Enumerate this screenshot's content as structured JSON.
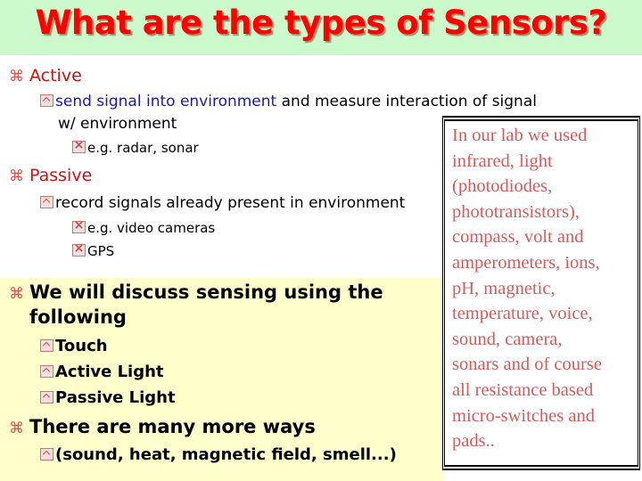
{
  "slide": {
    "title": "What are the types of Sensors?",
    "colors": {
      "title": "#ff0000",
      "title_band": "#ccf9cc",
      "heading": "#cc1111",
      "highlight": "#1a1aa6",
      "panel": "#ffffcc",
      "note_text": "#d65a5a"
    },
    "bullets": {
      "active": {
        "icon": "command-key-icon",
        "label": "Active",
        "sub": {
          "icon": "up-box-icon",
          "highlight": "send signal into environment",
          "rest_line1": " and measure interaction of signal",
          "rest_line2": "w/ environment",
          "example": {
            "icon": "x-box-icon",
            "label": "e.g. radar, sonar"
          }
        }
      },
      "passive": {
        "icon": "command-key-icon",
        "label": "Passive",
        "sub": {
          "icon": "up-box-icon",
          "label": "record signals already present in environment",
          "examples": [
            {
              "icon": "x-box-icon",
              "label": "e.g. video cameras"
            },
            {
              "icon": "x-box-icon",
              "label": "GPS"
            }
          ]
        }
      },
      "discuss": {
        "icon": "command-key-icon",
        "line1": "We will discuss sensing using the",
        "line2": "following",
        "items": [
          {
            "icon": "up-box-icon",
            "label": "Touch"
          },
          {
            "icon": "up-box-icon",
            "label": "Active Light"
          },
          {
            "icon": "up-box-icon",
            "label": "Passive Light"
          }
        ]
      },
      "more": {
        "icon": "command-key-icon",
        "label": "There are many more ways",
        "items": [
          {
            "icon": "up-box-icon",
            "label": "(sound, heat, magnetic field, smell...)"
          }
        ]
      }
    },
    "note": {
      "text": "In our lab we used\ninfrared, light\n(photodiodes,\nphototransistors),\ncompass, volt and\namperometers, ions,\npH, magnetic,\ntemperature, voice,\nsound, camera,\nsonars and of course\nall resistance based\nmicro-switches and\npads.."
    },
    "bullet_glyph": "⌘"
  }
}
